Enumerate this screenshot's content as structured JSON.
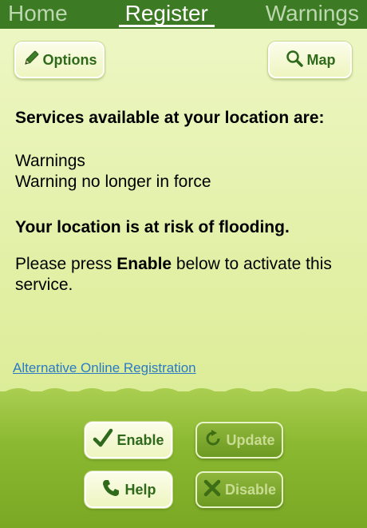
{
  "tabs": {
    "home": "Home",
    "register": "Register",
    "warnings": "Warnings"
  },
  "toolbar": {
    "options_label": "Options",
    "map_label": "Map"
  },
  "content": {
    "services_heading": "Services available at your location are:",
    "services": [
      "Warnings",
      "Warning no longer in force"
    ],
    "risk_text": "Your location is at risk of flooding.",
    "instruction_before": "Please press ",
    "instruction_bold": "Enable",
    "instruction_after": " below to activate this service.",
    "alt_link": "Alternative Online Registration"
  },
  "actions": {
    "enable_label": "Enable",
    "update_label": "Update",
    "help_label": "Help",
    "disable_label": "Disable"
  },
  "icons": {
    "options": "pencil-icon",
    "map": "magnifier-icon",
    "enable": "checkmark-icon",
    "update": "refresh-icon",
    "help": "phone-icon",
    "disable": "cross-icon"
  },
  "colors": {
    "tabbar": "#3d7a24",
    "accent_green": "#2f6a1c",
    "link": "#2a7ac7"
  }
}
